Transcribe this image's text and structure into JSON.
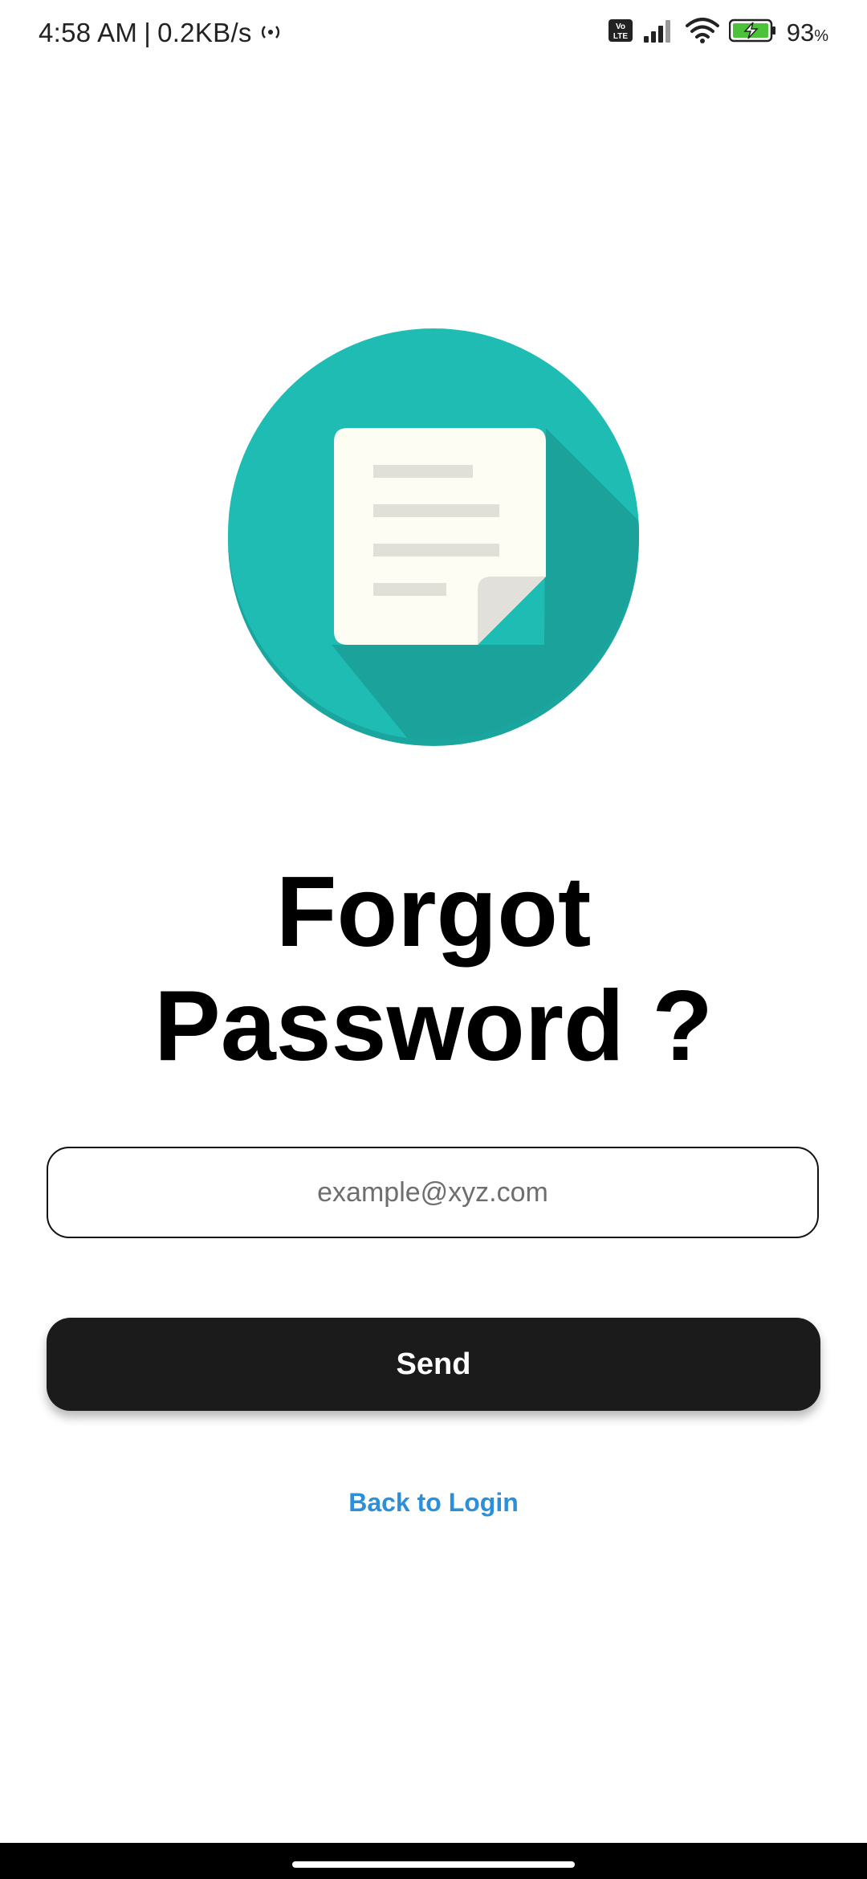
{
  "status_bar": {
    "time": "4:58 AM",
    "separator": "|",
    "network_speed": "0.2KB/s",
    "volte_label": "Vo LTE",
    "battery_percent": "93",
    "battery_unit": "%",
    "battery_level": 0.93,
    "icons": [
      "hotspot-icon",
      "volte-icon",
      "signal-icon",
      "wifi-icon",
      "battery-charging-icon"
    ]
  },
  "illustration": {
    "icon": "document-icon",
    "circle_color": "#1fbcb4",
    "shadow_color": "#1ba29b",
    "paper_color": "#fefdf3",
    "line_color": "#e0e0d8"
  },
  "title": {
    "line1": "Forgot",
    "line2": "Password ?"
  },
  "email": {
    "placeholder": "example@xyz.com",
    "value": ""
  },
  "send_button": {
    "label": "Send"
  },
  "back_link": {
    "label": "Back to Login",
    "color": "#2d8fd8"
  }
}
